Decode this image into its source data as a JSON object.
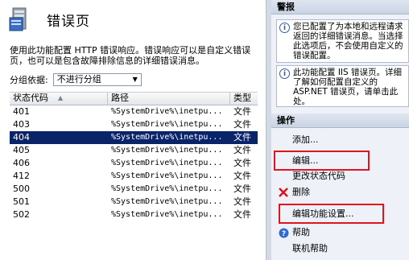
{
  "page": {
    "title": "错误页",
    "description": "使用此功能配置 HTTP 错误响应。错误响应可以是自定义错误页，也可以是包含故障排除信息的详细错误消息。"
  },
  "filter": {
    "label": "分组依据:",
    "value": "不进行分组"
  },
  "table": {
    "headers": [
      "状态代码",
      "路径",
      "类型"
    ],
    "rows": [
      {
        "code": "401",
        "path": "%SystemDrive%\\inetpu...",
        "type": "文件"
      },
      {
        "code": "403",
        "path": "%SystemDrive%\\inetpu...",
        "type": "文件"
      },
      {
        "code": "404",
        "path": "%SystemDrive%\\inetpu...",
        "type": "文件"
      },
      {
        "code": "405",
        "path": "%SystemDrive%\\inetpu...",
        "type": "文件"
      },
      {
        "code": "406",
        "path": "%SystemDrive%\\inetpu...",
        "type": "文件"
      },
      {
        "code": "412",
        "path": "%SystemDrive%\\inetpu...",
        "type": "文件"
      },
      {
        "code": "500",
        "path": "%SystemDrive%\\inetpu...",
        "type": "文件"
      },
      {
        "code": "501",
        "path": "%SystemDrive%\\inetpu...",
        "type": "文件"
      },
      {
        "code": "502",
        "path": "%SystemDrive%\\inetpu...",
        "type": "文件"
      }
    ],
    "selected_code": "404"
  },
  "alerts": {
    "title": "警报",
    "items": [
      {
        "text": "您已配置了为本地和远程请求返回的详细错误消息。当选择此选项后，不会使用自定义的错误配置。",
        "link": "自定义"
      },
      {
        "text": "此功能配置 IIS 错误页。详细了解如何配置自定义的 ASP.NET 错误页，请单击此处。",
        "link": "此处"
      }
    ]
  },
  "actions": {
    "title": "操作",
    "add": "添加...",
    "edit": "编辑...",
    "change_code": "更改状态代码",
    "delete": "删除",
    "edit_feature": "编辑功能设置...",
    "help": "帮助",
    "online_help": "联机帮助"
  },
  "colors": {
    "selection": "#0a246a",
    "highlight_box": "#e0141e",
    "link_icon": "#2b5fa8"
  }
}
